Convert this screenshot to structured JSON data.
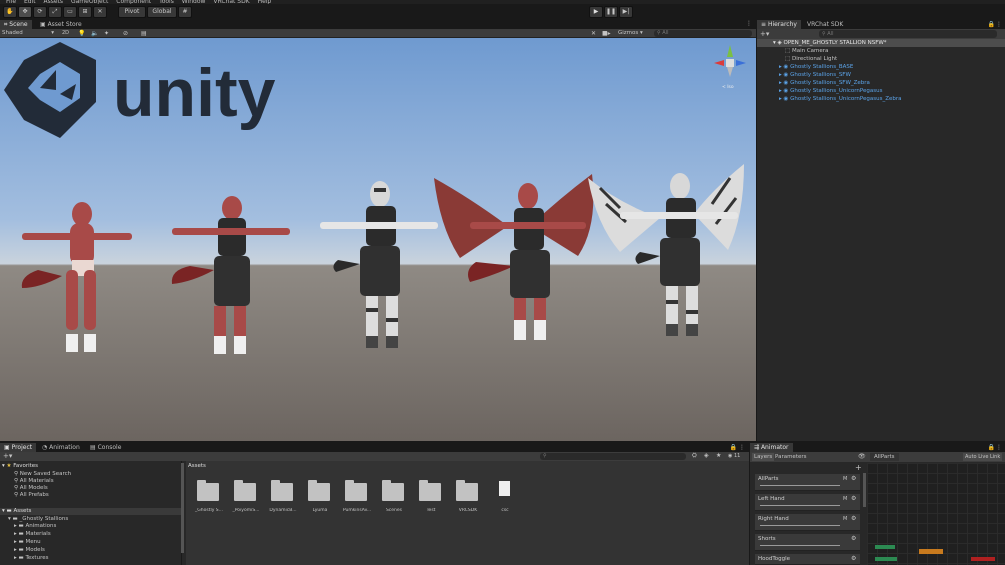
{
  "menu": [
    "File",
    "Edit",
    "Assets",
    "GameObject",
    "Component",
    "Tools",
    "Window",
    "VRChat SDK",
    "Help"
  ],
  "toolbar": {
    "pivot_label": "Pivot",
    "global_label": "Global"
  },
  "scene": {
    "tabs": [
      "Scene",
      "Asset Store"
    ],
    "shading_mode": "Shaded",
    "twod_label": "2D",
    "gizmos_label": "Gizmos",
    "search_placeholder": "All",
    "persp_label": "< Iso"
  },
  "hierarchy": {
    "tabs": [
      "Hierarchy",
      "VRChat SDK"
    ],
    "search_placeholder": "All",
    "root": "OPEN_ME_GHOSTLY STALLION NSFW*",
    "items": [
      {
        "label": "Main Camera",
        "type": "object"
      },
      {
        "label": "Directional Light",
        "type": "object"
      },
      {
        "label": "Ghostly Stallions_BASE",
        "type": "prefab"
      },
      {
        "label": "Ghostly Stallions_SFW",
        "type": "prefab"
      },
      {
        "label": "Ghostly Stallions_SFW_Zebra",
        "type": "prefab"
      },
      {
        "label": "Ghostly Stallions_UnicornPegasus",
        "type": "prefab"
      },
      {
        "label": "Ghostly Stallions_UnicornPegasus_Zebra",
        "type": "prefab"
      }
    ]
  },
  "project": {
    "tabs": [
      "Project",
      "Animation",
      "Console"
    ],
    "favorites_label": "Favorites",
    "favorites": [
      "New Saved Search",
      "All Materials",
      "All Models",
      "All Prefabs"
    ],
    "assets_label": "Assets",
    "tree_root": "_Ghostly Stallions",
    "tree_children": [
      "Animations",
      "Materials",
      "Menu",
      "Models",
      "Textures"
    ],
    "breadcrumb": "Assets",
    "count": "11",
    "folders": [
      "_Ghostly S...",
      "_PoiyomiS...",
      "DynamicB...",
      "Lyuma",
      "PumkinsAv...",
      "Scenes",
      "Test",
      "VRCSDK",
      "csc"
    ]
  },
  "animator": {
    "tab": "Animator",
    "subtabs": [
      "Layers",
      "Parameters"
    ],
    "breadcrumb": "AllParts",
    "auto_live": "Auto Live Link",
    "layers": [
      {
        "name": "AllParts",
        "tag": "M"
      },
      {
        "name": "Left Hand",
        "tag": "M"
      },
      {
        "name": "Right Hand",
        "tag": "M"
      },
      {
        "name": "Shorts",
        "tag": ""
      },
      {
        "name": "HoodToggle",
        "tag": ""
      }
    ]
  },
  "logo_text": "unity",
  "colors": {
    "accent": "#4f9de0",
    "prefab": "#5ba3e8",
    "panel": "#282828",
    "selected": "#4d4d4d"
  }
}
